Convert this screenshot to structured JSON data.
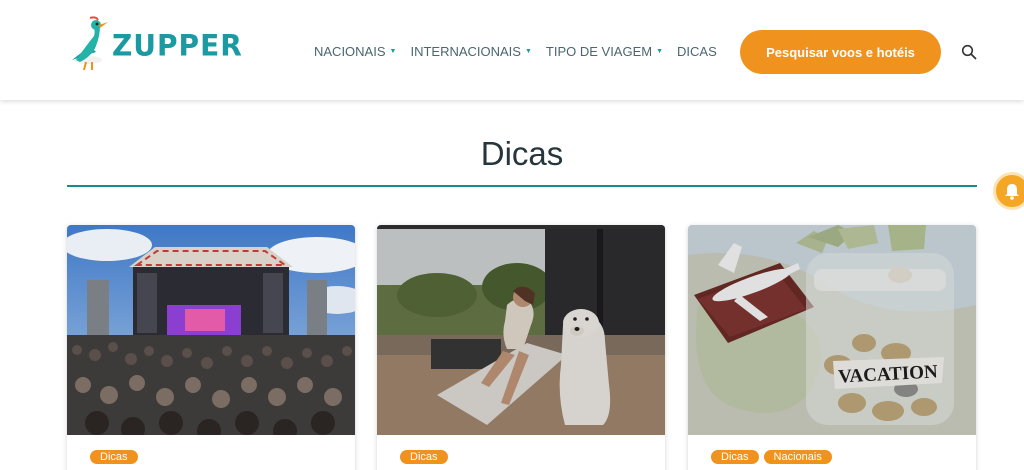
{
  "header": {
    "logo_text": "ZUPPER",
    "nav": [
      {
        "label": "NACIONAIS",
        "dropdown": true
      },
      {
        "label": "INTERNACIONAIS",
        "dropdown": true
      },
      {
        "label": "TIPO DE VIAGEM",
        "dropdown": true
      },
      {
        "label": "DICAS",
        "dropdown": false
      }
    ],
    "cta_label": "Pesquisar voos e hotéis",
    "search_icon": "search-icon"
  },
  "main": {
    "title": "Dicas",
    "cards": [
      {
        "image": "concert-crowd",
        "tags": [
          "Dicas"
        ]
      },
      {
        "image": "woman-with-dog",
        "tags": [
          "Dicas"
        ]
      },
      {
        "image": "vacation-jar",
        "tags": [
          "Dicas",
          "Nacionais"
        ],
        "image_text": "VACATION"
      }
    ]
  },
  "colors": {
    "accent": "#f0921e",
    "brand": "#1a9aa2",
    "title": "#26363c"
  }
}
